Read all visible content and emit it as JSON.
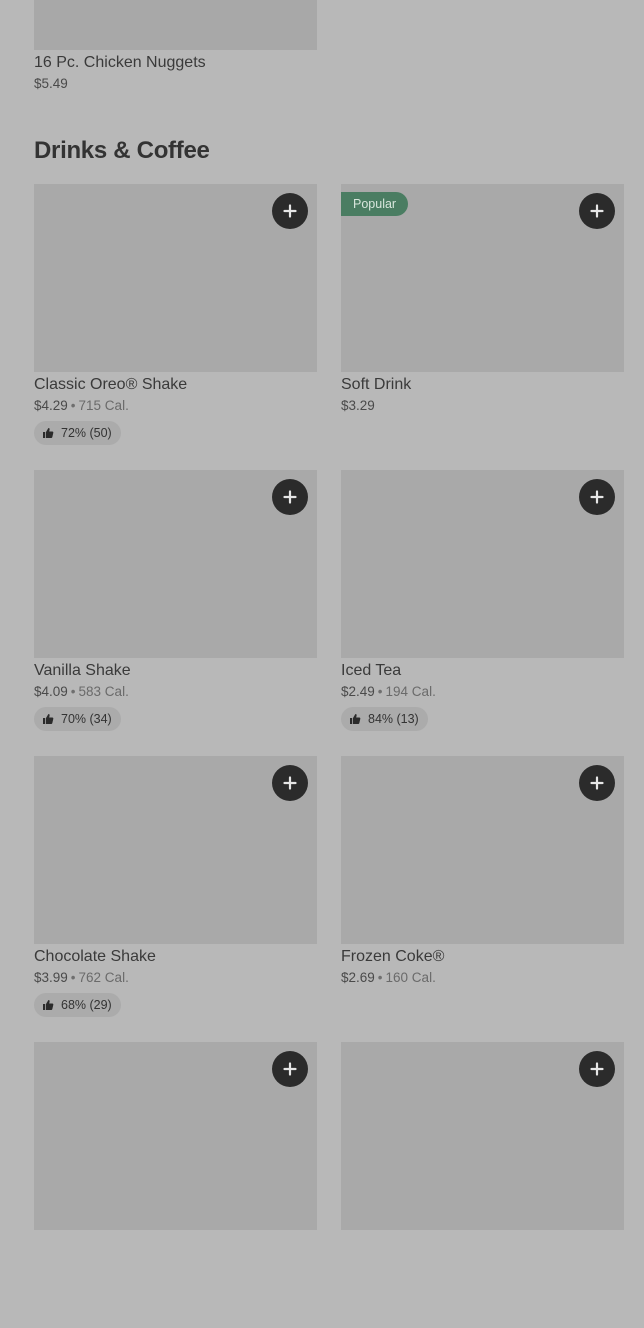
{
  "top_item": {
    "name": "16 Pc. Chicken Nuggets",
    "price": "$5.49"
  },
  "section": {
    "title": "Drinks & Coffee"
  },
  "items": [
    {
      "name": "Classic Oreo® Shake",
      "price": "$4.29",
      "separator": "•",
      "calories": "715 Cal.",
      "rating": "72% (50)",
      "badge": ""
    },
    {
      "name": "Soft Drink",
      "price": "$3.29",
      "separator": "",
      "calories": "",
      "rating": "",
      "badge": "Popular"
    },
    {
      "name": "Vanilla Shake",
      "price": "$4.09",
      "separator": "•",
      "calories": "583 Cal.",
      "rating": "70% (34)",
      "badge": ""
    },
    {
      "name": "Iced Tea",
      "price": "$2.49",
      "separator": "•",
      "calories": "194 Cal.",
      "rating": "84% (13)",
      "badge": ""
    },
    {
      "name": "Chocolate Shake",
      "price": "$3.99",
      "separator": "•",
      "calories": "762 Cal.",
      "rating": "68% (29)",
      "badge": ""
    },
    {
      "name": "Frozen Coke®",
      "price": "$2.69",
      "separator": "•",
      "calories": "160 Cal.",
      "rating": "",
      "badge": ""
    },
    {
      "name": "",
      "price": "",
      "separator": "",
      "calories": "",
      "rating": "",
      "badge": ""
    },
    {
      "name": "",
      "price": "",
      "separator": "",
      "calories": "",
      "rating": "",
      "badge": ""
    }
  ],
  "icons": {
    "add": "plus-icon",
    "rating": "thumbs-up-icon"
  },
  "colors": {
    "background": "#b8b8b8",
    "image_placeholder": "#a9a9a9",
    "add_button": "#2b2b2b",
    "popular_badge": "#4a7d62"
  }
}
